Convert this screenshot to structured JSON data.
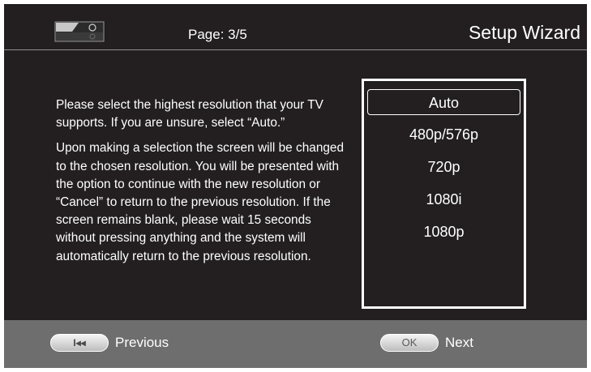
{
  "header": {
    "device_icon": "disc-player-icon",
    "page_label": "Page: 3/5",
    "title": "Setup Wizard"
  },
  "instructions": {
    "paragraph1": "Please select the highest resolution that your TV supports. If you are unsure, select “Auto.”",
    "paragraph2": "Upon making a selection the screen will be changed to the chosen resolution. You will be presented with the option to continue with the new resolution or “Cancel” to return to the previous resolution. If the screen remains blank, please wait 15 seconds without pressing anything and the system will automatically return to the previous resolution."
  },
  "resolutions": {
    "selected": "Auto",
    "options": [
      "Auto",
      "480p/576p",
      "720p",
      "1080i",
      "1080p"
    ]
  },
  "footer": {
    "previous": {
      "button_text": "I◂◂",
      "label": "Previous",
      "icon": "skip-back-icon"
    },
    "next": {
      "button_text": "OK",
      "label": "Next"
    }
  },
  "colors": {
    "background": "#231f20",
    "footer": "#6e6e6e",
    "text": "#ffffff"
  }
}
